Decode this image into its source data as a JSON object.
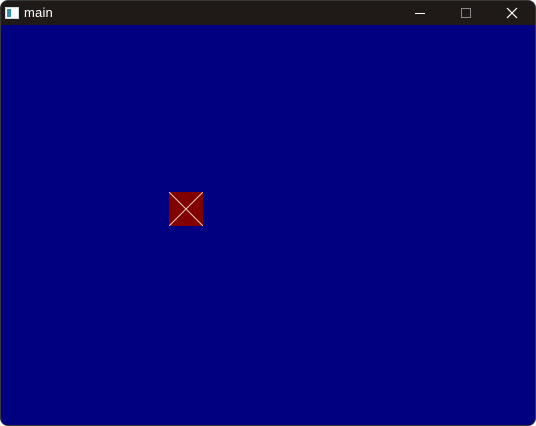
{
  "window": {
    "title": "main",
    "background_color": "#000080",
    "titlebar_color": "#1f1a17",
    "controls": {
      "minimize_icon": "minimize-icon",
      "maximize_icon": "maximize-icon",
      "close_icon": "close-icon"
    }
  },
  "canvas": {
    "sprite": {
      "icon": "crossed-square",
      "fill_color": "#800000",
      "cross_color": "#e8c8b8"
    }
  }
}
